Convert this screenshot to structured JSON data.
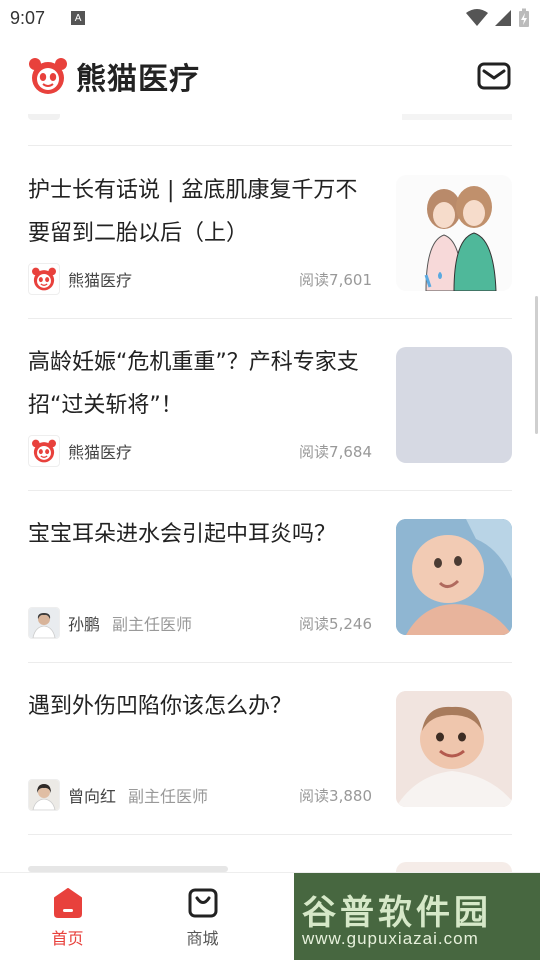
{
  "status_bar": {
    "time": "9:07",
    "notif_letter": "A"
  },
  "header": {
    "app_name": "熊猫医疗"
  },
  "articles": [
    {
      "title": "护士长有话说 | 盆底肌康复千万不要留到二胎以后（上）",
      "author": "熊猫医疗",
      "author_title": "",
      "reads": "阅读7,601"
    },
    {
      "title": "高龄妊娠“危机重重”？产科专家支招“过关斩将”！",
      "author": "熊猫医疗",
      "author_title": "",
      "reads": "阅读7,684"
    },
    {
      "title": "宝宝耳朵进水会引起中耳炎吗？",
      "author": "孙鹏",
      "author_title": "副主任医师",
      "reads": "阅读5,246"
    },
    {
      "title": "遇到外伤凹陷你该怎么办？",
      "author": "曾向红",
      "author_title": "副主任医师",
      "reads": "阅读3,880"
    }
  ],
  "bottom_nav": [
    {
      "label": "首页",
      "active": true
    },
    {
      "label": "商城",
      "active": false
    }
  ],
  "watermark": {
    "main": "谷普软件园",
    "url": "www.gupuxiazai.com"
  },
  "colors": {
    "brand": "#e8413c",
    "text": "#222222",
    "muted": "#999999"
  }
}
